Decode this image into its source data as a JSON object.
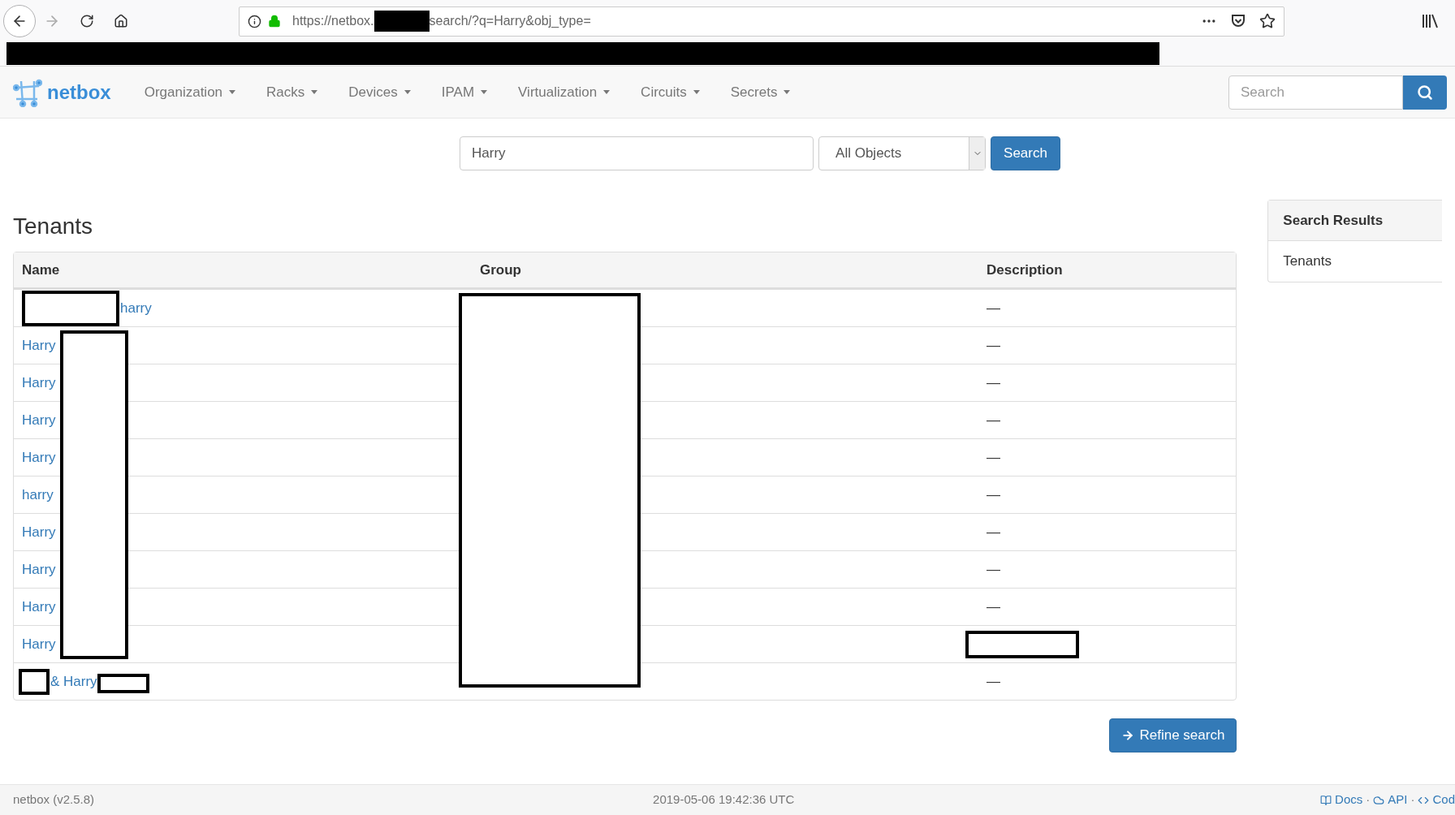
{
  "browser": {
    "url_start": "https://netbox.",
    "url_end": "search/?q=Harry&obj_type=",
    "url_redacted": true,
    "banner_redacted": true
  },
  "navbar": {
    "brand": "netbox",
    "menus": [
      "Organization",
      "Racks",
      "Devices",
      "IPAM",
      "Virtualization",
      "Circuits",
      "Secrets"
    ],
    "search": {
      "placeholder": "Search"
    }
  },
  "search_form": {
    "query": "Harry",
    "object_type": "All Objects",
    "button": "Search"
  },
  "section": {
    "title": "Tenants"
  },
  "table": {
    "columns": [
      "Name",
      "Group",
      "Description"
    ],
    "group_redacted": true,
    "rows": [
      {
        "name": "harry",
        "redacted_before": true,
        "description": "—"
      },
      {
        "name": "Harry",
        "redacted_after": true,
        "description": "—"
      },
      {
        "name": "Harry",
        "redacted_after": true,
        "description": "—"
      },
      {
        "name": "Harry",
        "redacted_after": true,
        "description": "—"
      },
      {
        "name": "Harry",
        "redacted_after": true,
        "description": "—"
      },
      {
        "name": "harry",
        "redacted_after": true,
        "description": "—"
      },
      {
        "name": "Harry",
        "redacted_after": true,
        "description": "—"
      },
      {
        "name": "Harry",
        "redacted_after": true,
        "description": "—"
      },
      {
        "name": "Harry",
        "redacted_after": true,
        "description": "—"
      },
      {
        "name": "Harry",
        "redacted_after": true,
        "description_redacted": true
      },
      {
        "name": "& Harry",
        "redacted_before": true,
        "redacted_after": true,
        "description": "—"
      }
    ]
  },
  "refine_button": "Refine search",
  "sidebar": {
    "title": "Search Results",
    "items": [
      "Tenants"
    ]
  },
  "footer": {
    "version": "netbox (v2.5.8)",
    "time": "2019-05-06 19:42:36 UTC",
    "links": [
      "Docs",
      "API",
      "Cod"
    ],
    "separators": [
      "·",
      "·"
    ]
  }
}
